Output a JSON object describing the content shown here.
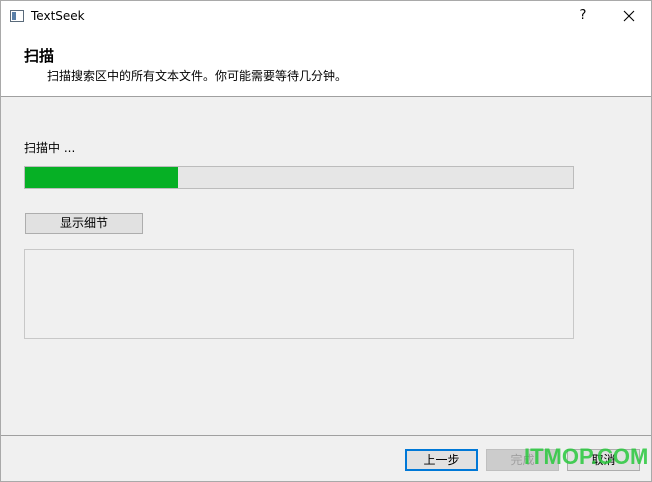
{
  "window": {
    "title": "TextSeek",
    "help_label": "?"
  },
  "header": {
    "title": "扫描",
    "subtitle": "扫描搜索区中的所有文本文件。你可能需要等待几分钟。"
  },
  "content": {
    "status_label": "扫描中 ...",
    "progress_fraction": 0.28,
    "progress_color": "#06b025",
    "details_button_label": "显示细节"
  },
  "footer": {
    "back_label": "上一步",
    "finish_label": "完成",
    "cancel_label": "取消"
  },
  "watermark": "ITMOP.COM"
}
